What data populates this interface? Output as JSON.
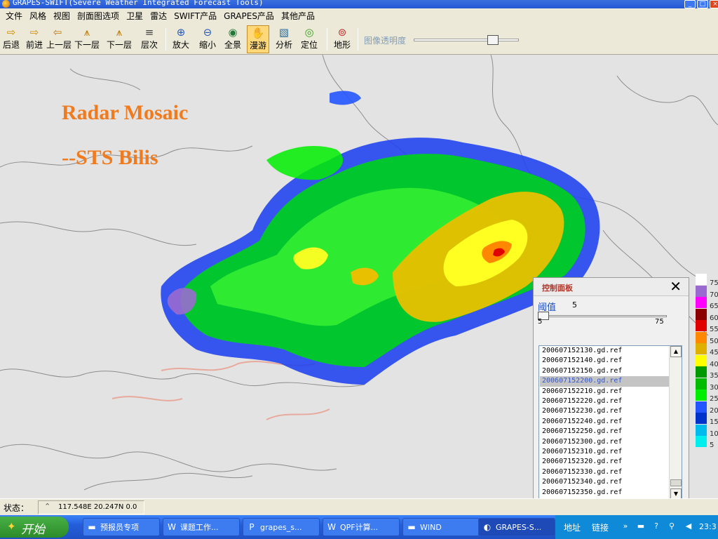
{
  "window": {
    "title": "GRAPES-SWIFT(Severe Weather Integrated Forecast Tools)",
    "controls": [
      "minimize",
      "restore",
      "close"
    ]
  },
  "menu": [
    "文件",
    "风格",
    "视图",
    "剖面图选项",
    "卫星",
    "雷达",
    "SWIFT产品",
    "GRAPES产品",
    "其他产品"
  ],
  "toolbar": {
    "buttons": [
      {
        "label": "后退",
        "icon": "arrow-left-icon",
        "glyph": "⇨"
      },
      {
        "label": "前进",
        "icon": "arrow-right-icon",
        "glyph": "⇨"
      },
      {
        "label": "上一层",
        "icon": "layer-up-icon",
        "glyph": "⇦"
      },
      {
        "label": "下一层",
        "icon": "layer-down-icon",
        "glyph": "⩚"
      },
      {
        "label": "层次",
        "icon": "layers-icon",
        "glyph": "≡"
      },
      {
        "label": "放大",
        "icon": "zoom-in-icon",
        "glyph": "⊕"
      },
      {
        "label": "缩小",
        "icon": "zoom-out-icon",
        "glyph": "⊖"
      },
      {
        "label": "全景",
        "icon": "globe-icon",
        "glyph": "◉"
      },
      {
        "label": "漫游",
        "icon": "pan-hand-icon",
        "glyph": "✋"
      },
      {
        "label": "分析",
        "icon": "chart-icon",
        "glyph": "▧"
      },
      {
        "label": "定位",
        "icon": "locate-icon",
        "glyph": "◎"
      },
      {
        "label": "地形",
        "icon": "terrain-icon",
        "glyph": "⊚"
      }
    ],
    "active": "漫游",
    "opacity_label": "图像透明度",
    "opacity_value": 0.78
  },
  "map": {
    "overlay_title_line1": "Radar Mosaic",
    "overlay_title_line2": "--STS Bilis",
    "background": "#e3e3e3",
    "coast_color": "#8c8c8c",
    "river_color": "#e8a090"
  },
  "legend": [
    {
      "label": "75",
      "color": "#ffffff"
    },
    {
      "label": "70",
      "color": "#9a6ad0"
    },
    {
      "label": "65",
      "color": "#ff00ff"
    },
    {
      "label": "60",
      "color": "#8b0000"
    },
    {
      "label": "55",
      "color": "#e00000"
    },
    {
      "label": "50",
      "color": "#ff8800"
    },
    {
      "label": "45",
      "color": "#e0b000"
    },
    {
      "label": "40",
      "color": "#ffff00"
    },
    {
      "label": "35",
      "color": "#009900"
    },
    {
      "label": "30",
      "color": "#00bb00"
    },
    {
      "label": "25",
      "color": "#00ee00"
    },
    {
      "label": "20",
      "color": "#2255ff"
    },
    {
      "label": "15",
      "color": "#0033cc"
    },
    {
      "label": "10",
      "color": "#00bbee"
    },
    {
      "label": "5",
      "color": "#00eeee"
    }
  ],
  "control_panel": {
    "title": "控制面板",
    "threshold_label": "阈值",
    "threshold_value": "5",
    "threshold_min": "5",
    "threshold_max": "75",
    "files": [
      "200607152130.gd.ref",
      "200607152140.gd.ref",
      "200607152150.gd.ref",
      "200607152200.gd.ref",
      "200607152210.gd.ref",
      "200607152220.gd.ref",
      "200607152230.gd.ref",
      "200607152240.gd.ref",
      "200607152250.gd.ref",
      "200607152300.gd.ref",
      "200607152310.gd.ref",
      "200607152320.gd.ref",
      "200607152330.gd.ref",
      "200607152340.gd.ref",
      "200607152350.gd.ref"
    ],
    "selected_file": "200607152200.gd.ref"
  },
  "status": {
    "label": "状态：",
    "coords": "117.548E 20.247N 0.0"
  },
  "taskbar": {
    "start_label": "开始",
    "tasks": [
      {
        "label": "预报员专项",
        "icon": "folder-icon",
        "glyph": "▬"
      },
      {
        "label": "课题工作...",
        "icon": "word-doc-icon",
        "glyph": "W"
      },
      {
        "label": "grapes_s...",
        "icon": "ppt-doc-icon",
        "glyph": "P"
      },
      {
        "label": "QPF计算...",
        "icon": "word-doc-icon",
        "glyph": "W"
      },
      {
        "label": "WIND",
        "icon": "folder-icon",
        "glyph": "▬"
      },
      {
        "label": "GRAPES-S...",
        "icon": "app-icon",
        "glyph": "◐"
      }
    ],
    "address_label": "地址",
    "links_label": "链接",
    "clock": "23:3"
  }
}
